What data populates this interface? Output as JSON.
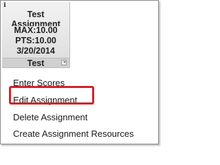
{
  "header": {
    "info_icon": "i",
    "title": "Test Assignment",
    "max_line": "MAX:10.00",
    "pts_line": "PTS:10.00",
    "date_line": "3/20/2014",
    "category": "Test",
    "sort_icon": "sort-icon"
  },
  "menu": {
    "items": [
      {
        "label": "Enter Scores"
      },
      {
        "label": "Edit Assignment"
      },
      {
        "label": "Delete Assignment"
      },
      {
        "label": "Create Assignment Resources"
      }
    ],
    "highlight_color": "#d0232a"
  }
}
